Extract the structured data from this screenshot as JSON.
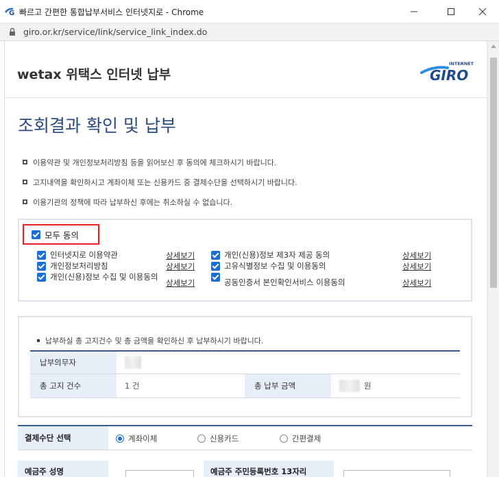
{
  "window": {
    "title": "빠르고 간편한 통합납부서비스 인터넷지로 - Chrome",
    "url": "giro.or.kr/service/link/service_link_index.do"
  },
  "header": {
    "brand": "wetax 위택스 인터넷 납부",
    "logo_text": "GIRO",
    "logo_small": "INTERNET"
  },
  "page_title": "조회결과 확인 및 납부",
  "notices": [
    "이용약관 및 개인정보처리방침 등을 읽어보신 후 동의에 체크하시기 바랍니다.",
    "고지내역을 확인하시고 계좌이체 또는 신용카드 중 결제수단을 선택하시기 바랍니다.",
    "이용기관의 정책에 따라 납부하신 후에는 취소하실 수 없습니다."
  ],
  "agree_all": {
    "label": "모두 동의",
    "checked": true
  },
  "detail_label": "상세보기",
  "terms_left": [
    {
      "label": "인터넷지로 이용약관",
      "checked": true
    },
    {
      "label": "개인정보처리방침",
      "checked": true
    },
    {
      "label": "개인(신용)정보 수집 및 이용동의",
      "checked": true
    }
  ],
  "terms_right": [
    {
      "label": "개인(신용)정보 제3자 제공 동의",
      "checked": true
    },
    {
      "label": "고유식별정보 수집 및 이용동의",
      "checked": true
    },
    {
      "label": "공동인증서 본인확인서비스 이용동의",
      "checked": true
    }
  ],
  "summary": {
    "notice": "납부하실 총 고지건수 및 총 금액을 확인하신 후 납부하시기 바랍니다.",
    "payer_label": "납부의무자",
    "count_label": "총 고지 건수",
    "count_value": "1 건",
    "amount_label": "총 납부 금액",
    "amount_unit": "원"
  },
  "payment": {
    "label": "결제수단 선택",
    "options": [
      {
        "label": "계좌이체",
        "selected": true
      },
      {
        "label": "신용카드",
        "selected": false
      },
      {
        "label": "간편결제",
        "selected": false
      }
    ]
  },
  "bottom": {
    "left_label": "예금주 성명",
    "right_label": "예금주 주민등록번호 13자리"
  },
  "colors": {
    "accent": "#1c6fd0",
    "title": "#2b4b7e",
    "table_header_bg": "#e7eef7",
    "highlight_border": "#e52020"
  }
}
